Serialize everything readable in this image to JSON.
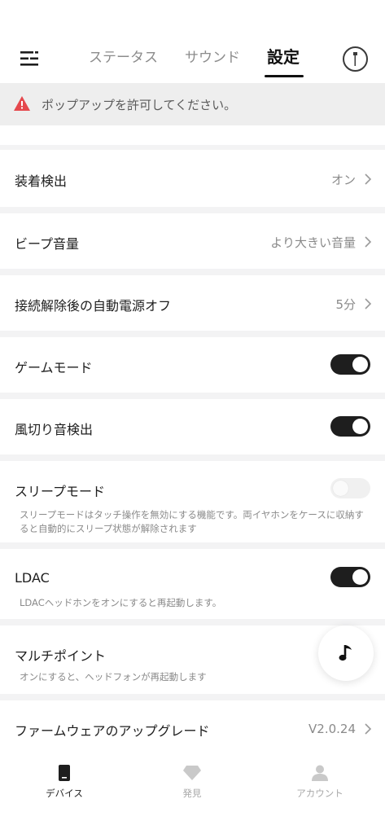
{
  "header": {
    "tabs": [
      {
        "label": "ステータス"
      },
      {
        "label": "サウンド"
      },
      {
        "label": "設定"
      }
    ],
    "active_tab": "設定"
  },
  "warning": {
    "text": "ポップアップを許可してください。",
    "color": "#e5484d"
  },
  "settings": {
    "wear_detection": {
      "label": "装着検出",
      "value": "オン"
    },
    "beep_volume": {
      "label": "ビープ音量",
      "value": "より大きい音量"
    },
    "auto_power_off": {
      "label": "接続解除後の自動電源オフ",
      "value": "5分"
    },
    "game_mode": {
      "label": "ゲームモード",
      "state": "on"
    },
    "wind_noise": {
      "label": "風切り音検出",
      "state": "on"
    },
    "sleep_mode": {
      "label": "スリープモード",
      "state": "off",
      "description": "スリープモードはタッチ操作を無効にする機能です。両イヤホンをケースに収納すると自動的にスリープ状態が解除されます"
    },
    "ldac": {
      "label": "LDAC",
      "state": "on",
      "description": "LDACヘッドホンをオンにすると再起動します。"
    },
    "multipoint": {
      "label": "マルチポイント",
      "description": "オンにすると、ヘッドフォンが再起動します"
    },
    "firmware": {
      "label": "ファームウェアのアップグレード",
      "value": "V2.0.24"
    }
  },
  "bottom_nav": {
    "items": [
      {
        "label": "デバイス",
        "icon": "device-icon",
        "active": true
      },
      {
        "label": "発見",
        "icon": "diamond-icon",
        "active": false
      },
      {
        "label": "アカウント",
        "icon": "person-icon",
        "active": false
      }
    ]
  }
}
